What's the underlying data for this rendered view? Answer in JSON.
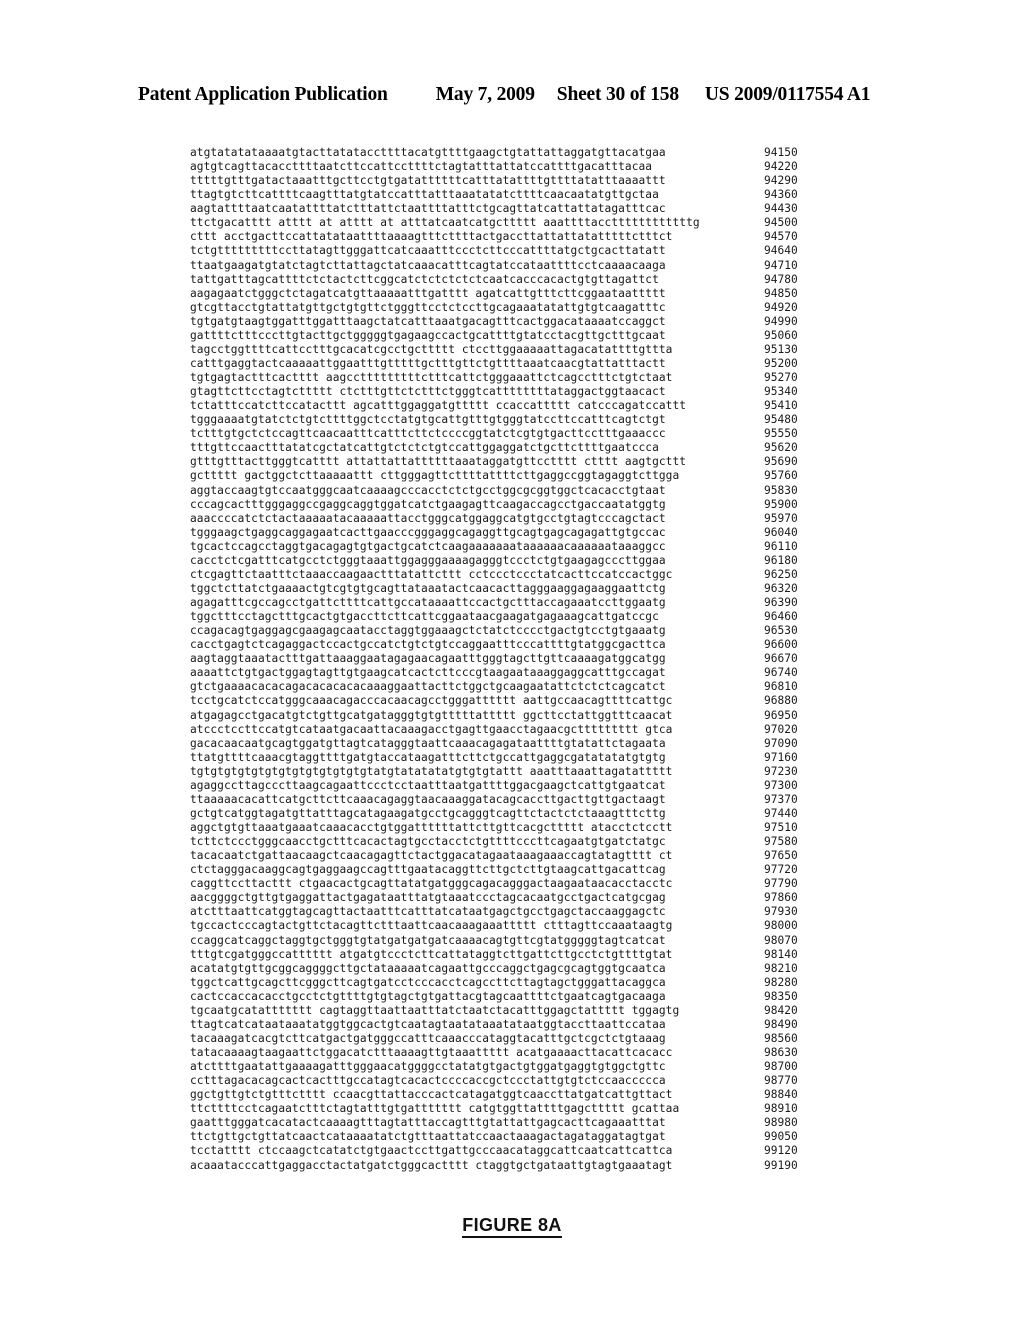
{
  "header": {
    "publication": "Patent Application Publication",
    "date": "May 7, 2009",
    "sheet": "Sheet 30 of 158",
    "patent_number": "US 2009/0117554 A1"
  },
  "figure": {
    "caption": "FIGURE 8A"
  },
  "sequence": {
    "line_step": 70,
    "first_position": "94150",
    "last_position": "99190",
    "rows": [
      {
        "bases": "atgtatatataaaatgtacttatataccttttacatgttttgaagctgtattattaggatgttacatgaa",
        "position": "94150"
      },
      {
        "bases": "agtgtcagttacaccttttaatcttccattccttttctagtatttattatccattttgacatttacaa",
        "position": "94220"
      },
      {
        "bases": "tttttgtttgatactaaatttgcttcctgtgatattttttcatttatattttgttttatatttaaaattt",
        "position": "94290"
      },
      {
        "bases": "ttagtgtcttcattttcaagtttatgtatccatttatttaaatatatcttttcaacaatatgttgctaa",
        "position": "94360"
      },
      {
        "bases": "aagtattttaatcaatattttatctttattctaattttatttctgcagttatcattattatagatttcac",
        "position": "94430"
      },
      {
        "bases": "ttctgacatttt atttt at atttt at atttatcaatcatgcttttt aaattttaccttttttttttttg",
        "position": "94500"
      },
      {
        "bases": "cttt acctgacttccattatataattttaaaagtttcttttactgaccttattattatatttttctttct",
        "position": "94570"
      },
      {
        "bases": "tctgtttttttttccttatagttgggattcatcaaatttccctcttcccattttatgctgcacttatatt",
        "position": "94640"
      },
      {
        "bases": "ttaatgaagatgtatctagtcttattagctatcaaacatttcagtatccataattttcctcaaaacaaga",
        "position": "94710"
      },
      {
        "bases": "tattgatttagcattttctctactcttcggcatctctctctctcaatcacccacactgtgttagattct",
        "position": "94780"
      },
      {
        "bases": "aagagaatctgggctctagatcatgttaaaaatttgatttt agatcattgtttcttcggaataattttt",
        "position": "94850"
      },
      {
        "bases": "gtcgttacctgtattatgttgctgtgttctgggttcctctccttgcagaaatatattgtgtcaagatttc",
        "position": "94920"
      },
      {
        "bases": "tgtgatgtaagtggatttggatttaagctatcatttaaatgacagtttcactggacataaaatccaggct",
        "position": "94990"
      },
      {
        "bases": "gattttctttcccttgtacttgctgggggtgagaagccactgcattttgtatcctacgttgctttgcaat",
        "position": "95060"
      },
      {
        "bases": "tagcctggttttcattcctttgcacatcgcctgcttttt ctccttggaaaaattagacatattttgttta",
        "position": "95130"
      },
      {
        "bases": "catttgaggtactcaaaaattggaatttgtttttgctttgttctgttttaaatcaacgtattatttactt",
        "position": "95200"
      },
      {
        "bases": "tgtgagtactttcactttt aagcctttttttttctttcattctgggaaattctcagcctttctgtctaat",
        "position": "95270"
      },
      {
        "bases": "gtagttcttcctagtcttttt ctctttgttctctttctgggtcattttttttataggactggtaacact",
        "position": "95340"
      },
      {
        "bases": "tctatttccatcttccatacttt agcatttggaggatgttttt ccaccattttt catcccagatccattt",
        "position": "95410"
      },
      {
        "bases": "tgggaaaatgtatctctgtcttttggctcctatgtgcattgtttgtgggtatccttccatttcagtctgt",
        "position": "95480"
      },
      {
        "bases": "tctttgtgctctccagttcaacaatttcatttcttctccccggtatctcgtgtgacttcctttgaaaccc",
        "position": "95550"
      },
      {
        "bases": "tttgttccaactttatatcgctatcattgtctctctgtccattggaggatctgcttcttttgaatccca",
        "position": "95620"
      },
      {
        "bases": "gtttgtttacttgggtcatttt attattattattttttaaataggatgttcctttt ctttt aagtgcttt",
        "position": "95690"
      },
      {
        "bases": "gcttttt gactggctcttaaaaattt cttgggagttcttttattttcttgaggccggtagaggtcttgga",
        "position": "95760"
      },
      {
        "bases": "aggtaccaagtgtccaatgggcaatcaaaagcccacctctctgcctggcgcggtggctcacacctgtaat",
        "position": "95830"
      },
      {
        "bases": "cccagcactttgggaggccgaggcaggtggatcatctgaagagttcaagaccagcctgaccaatatggtg",
        "position": "95900"
      },
      {
        "bases": "aaaccccatctctactaaaaatacaaaaattacctgggcatggaggcatgtgcctgtagtcccagctact",
        "position": "95970"
      },
      {
        "bases": "tgggaagctgaggcaggagaatcacttgaacccgggaggcagaggttgcagtgagcagagattgtgccac",
        "position": "96040"
      },
      {
        "bases": "tgcactccagcctaggtgacagagtgtgactgcatctcaagaaaaaaataaaaaacaaaaaataaaggcc",
        "position": "96110"
      },
      {
        "bases": "cacctctcgatttcatgcctctgggtaaattggagggaaaagagggtccctctgtgaagagcccttggaa",
        "position": "96180"
      },
      {
        "bases": "ctcgagttctaatttctaaaccaagaactttatattcttt cctccctccctatcacttccatccactggc",
        "position": "96250"
      },
      {
        "bases": "tggctcttatctgaaaactgtcgtgtgcagttataaatactcaacacttagggaaggagaaggaattctg",
        "position": "96320"
      },
      {
        "bases": "agagatttcgccagcctgattcttttcattgccataaaattccactgctttaccagaaatccttggaatg",
        "position": "96390"
      },
      {
        "bases": "tggctttcctagctttgcactgtgaccttcttcattcggaataacgaagatgagaaagcattgatccgc",
        "position": "96460"
      },
      {
        "bases": "ccagacagtgaggagcgaagagcaatacctaggtggaaagctctatctcccctgactgtcctgtgaaatg",
        "position": "96530"
      },
      {
        "bases": "cacctgagtctcagaggactccactgccatctgtctgtccaggaatttcccattttgtatggcgacttca",
        "position": "96600"
      },
      {
        "bases": "aagtaggtaaatactttgattaaaggaatagagaacagaatttgggtagcttgttcaaaagatggcatgg",
        "position": "96670"
      },
      {
        "bases": "aaaattctgtgactggagtagttgtgaagcatcactcttcccgtaagaataaaggaggcatttgccagat",
        "position": "96740"
      },
      {
        "bases": "gtctgaaaacacacagacacacacacaaaggaattacttctggctgcaagaatattctctctcagcatct",
        "position": "96810"
      },
      {
        "bases": "tcctgcatctccatgggcaaacagacccacaacagcctgggatttttt aattgccaacagttttcattgc",
        "position": "96880"
      },
      {
        "bases": "atgagagcctgacatgtctgttgcatgatagggtgtgtttttattttt ggcttcctattggtttcaacat",
        "position": "96950"
      },
      {
        "bases": "atccctccttccatgtcataatgacaattacaaagacctgagttgaacctagaacgcttttttttt gtca",
        "position": "97020"
      },
      {
        "bases": "gacacaacaatgcagtggatgttagtcatagggtaattcaaacagagataattttgtatattctagaata",
        "position": "97090"
      },
      {
        "bases": "ttatgttttcaaacgtaggttttgatgtaccataagatttcttctgccattgaggcgatatatatgtgtg",
        "position": "97160"
      },
      {
        "bases": "tgtgtgtgtgtgtgtgtgtgtgtgtgtatgtatatatatgtgtgtattt aaatttaaattagatattttt",
        "position": "97230"
      },
      {
        "bases": "agaggccttagcccttaagcagaattccctcctaatttaatgattttggacgaagctcattgtgaatcat",
        "position": "97300"
      },
      {
        "bases": "ttaaaaacacattcatgcttcttcaaacagaggtaacaaaggatacagcaccttgacttgttgactaagt",
        "position": "97370"
      },
      {
        "bases": "gctgtcatggtagatgttatttagcatagaagatgcctgcagggtcagttctactctctaaagtttcttg",
        "position": "97440"
      },
      {
        "bases": "aggctgtgttaaatgaaatcaaacacctgtggattttttattcttgttcacgcttttt atacctctcctt",
        "position": "97510"
      },
      {
        "bases": "tcttctccctgggcaacctgctttcacactagtgcctacctctgttttcccttcagaatgtgatctatgc",
        "position": "97580"
      },
      {
        "bases": "tacacaatctgattaacaagctcaacagagttctactggacatagaataaagaaaccagtatagtttt ct",
        "position": "97650"
      },
      {
        "bases": "ctctagggacaaggcagtgaggaagccagtttgaatacaggttcttgctcttgtaagcattgacattcag",
        "position": "97720"
      },
      {
        "bases": "caggttccttacttt ctgaacactgcagttatatgatgggcagacagggactaagaataacacctacctc",
        "position": "97790"
      },
      {
        "bases": "aacggggctgttgtgaggattactgagataatttatgtaaatccctagcacaatgcctgactcatgcgag",
        "position": "97860"
      },
      {
        "bases": "atctttaattcatggtagcagttactaatttcatttatcataatgagctgcctgagctaccaaggagctc",
        "position": "97930"
      },
      {
        "bases": "tgccactcccagtactgttctacagttctttaattcaacaaagaaattttt ctttagttccaaataagtg",
        "position": "98000"
      },
      {
        "bases": "ccaggcatcaggctaggtgctgggtgtatgatgatgatcaaaacagtgttcgtatgggggtagtcatcat",
        "position": "98070"
      },
      {
        "bases": "tttgtcgatgggccatttttt atgatgtccctcttcattataggtcttgattcttgcctctgttttgtat",
        "position": "98140"
      },
      {
        "bases": "acatatgtgttgcggcaggggcttgctataaaaatcagaattgcccaggctgagcgcagtggtgcaatca",
        "position": "98210"
      },
      {
        "bases": "tggctcattgcagcttcgggcttcagtgatcctcccacctcagccttcttagtagctgggattacaggca",
        "position": "98280"
      },
      {
        "bases": "cactccaccacacctgcctctgttttgtgtagctgtgattacgtagcaattttctgaatcagtgacaaga",
        "position": "98350"
      },
      {
        "bases": "tgcaatgcatattttttt cagtaggttaattaatttatctaatctacatttggagctattttt tggagtg",
        "position": "98420"
      },
      {
        "bases": "ttagtcatcataataaatatggtggcactgtcaatagtaatataaatataatggtaccttaattccataa",
        "position": "98490"
      },
      {
        "bases": "tacaaagatcacgtcttcatgactgatgggccatttcaaacccataggtacatttgctcgctctgtaaag",
        "position": "98560"
      },
      {
        "bases": "tatacaaaagtaagaattctggacatctttaaaagttgtaaattttt acatgaaaacttacattcacacc",
        "position": "98630"
      },
      {
        "bases": "atcttttgaatattgaaaagatttgggaacatggggcctatatgtgactgtggatgaggtgtggctgttc",
        "position": "98700"
      },
      {
        "bases": "cctttagacacagcactcactttgccatagtcacactccccaccgctccctattgtgtctccaaccccca",
        "position": "98770"
      },
      {
        "bases": "ggctgttgtctgtttctttt ccaacgttattacccactcatagatggtcaaccttatgatcattgttact",
        "position": "98840"
      },
      {
        "bases": "ttcttttcctcagaatctttctagtatttgtgattttttt catgtggttattttgagcttttt gcattaa",
        "position": "98910"
      },
      {
        "bases": "gaatttgggatcacatactcaaaagtttagtatttaccagtttgtattattgagcacttcagaaatttat",
        "position": "98980"
      },
      {
        "bases": "ttctgttgctgttatcaactcataaaatatctgtttaattatccaactaaagactagataggatagtgat",
        "position": "99050"
      },
      {
        "bases": "tcctatttt ctccaagctcatatctgtgaactccttgattgcccaacataggcattcaatcattcattca",
        "position": "99120"
      },
      {
        "bases": "acaaatacccattgaggacctactatgatctgggcactttt ctaggtgctgataattgtagtgaaatagt",
        "position": "99190"
      }
    ]
  }
}
